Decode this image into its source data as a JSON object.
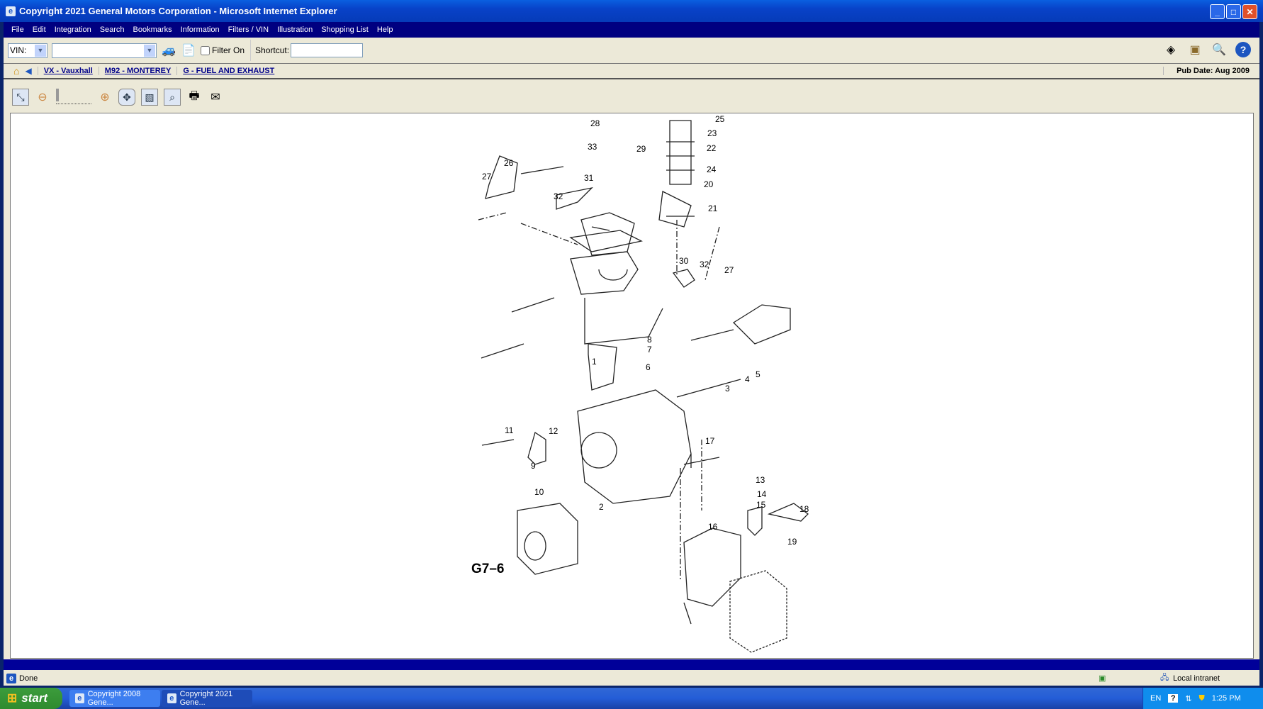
{
  "window": {
    "title": "Copyright 2021 General Motors Corporation - Microsoft Internet Explorer"
  },
  "menu": [
    "File",
    "Edit",
    "Integration",
    "Search",
    "Bookmarks",
    "Information",
    "Filters / VIN",
    "Illustration",
    "Shopping List",
    "Help"
  ],
  "toolbar": {
    "vin_label": "VIN:",
    "vin_value": "",
    "filter_label": "Filter On",
    "filter_checked": false,
    "shortcut_label": "Shortcut:",
    "shortcut_value": ""
  },
  "breadcrumb": [
    "VX - Vauxhall",
    "M92 - MONTEREY",
    "G - FUEL AND EXHAUST"
  ],
  "pub_date": "Pub Date: Aug 2009",
  "illustration": {
    "figure_id": "G7–6",
    "callouts": [
      "28",
      "25",
      "23",
      "22",
      "24",
      "33",
      "29",
      "26",
      "27",
      "31",
      "32",
      "20",
      "21",
      "30",
      "32",
      "27",
      "8",
      "7",
      "6",
      "1",
      "3",
      "4",
      "5",
      "11",
      "12",
      "17",
      "9",
      "10",
      "2",
      "13",
      "14",
      "15",
      "18",
      "16",
      "19"
    ]
  },
  "status": {
    "text": "Done",
    "zone": "Local intranet"
  },
  "taskbar": {
    "start": "start",
    "tasks": [
      "Copyright 2008 Gene...",
      "Copyright 2021 Gene..."
    ],
    "lang": "EN",
    "time": "1:25 PM"
  }
}
